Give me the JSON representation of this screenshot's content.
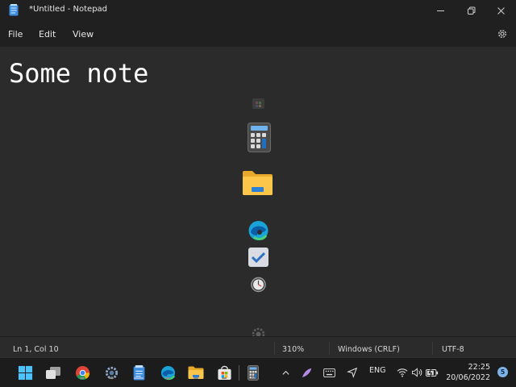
{
  "window": {
    "title": "*Untitled - Notepad"
  },
  "menu": {
    "file": "File",
    "edit": "Edit",
    "view": "View"
  },
  "editor": {
    "content": "Some note"
  },
  "status": {
    "position": "Ln 1, Col 10",
    "zoom": "310%",
    "line_ending": "Windows (CRLF)",
    "encoding": "UTF-8"
  },
  "taskbar": {
    "language": "ENG",
    "time": "22:25",
    "date": "20/06/2022",
    "notification_count": "5"
  },
  "colors": {
    "accent": "#9ab8e8",
    "background": "#202020",
    "editor_bg": "#2b2b2b"
  }
}
